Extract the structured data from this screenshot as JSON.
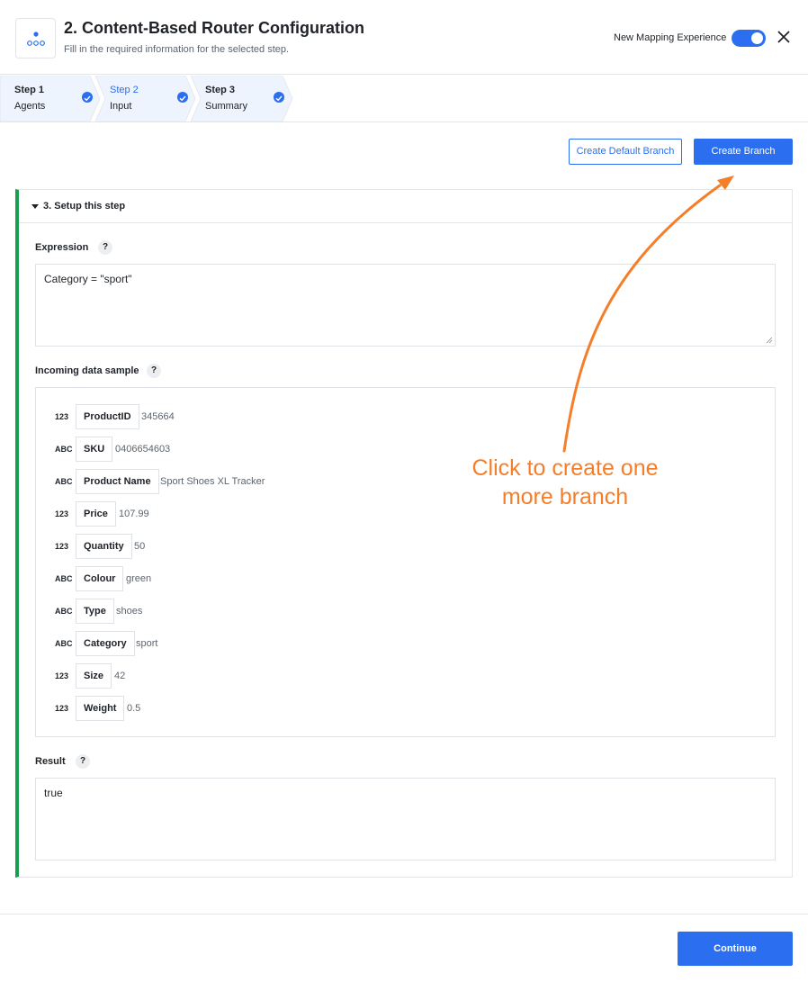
{
  "header": {
    "title": "2. Content-Based Router Configuration",
    "subtitle": "Fill in the required information for the selected step.",
    "toggle_label": "New Mapping Experience",
    "toggle_on": true,
    "app_icon": "router-icon",
    "close_icon": "close-icon"
  },
  "steps": [
    {
      "number": "Step 1",
      "name": "Agents",
      "completed": true
    },
    {
      "number": "Step 2",
      "name": "Input",
      "completed": true,
      "active": true
    },
    {
      "number": "Step 3",
      "name": "Summary",
      "completed": true
    }
  ],
  "actions": {
    "create_default_branch": "Create Default Branch",
    "create_branch": "Create Branch"
  },
  "section": {
    "title": "3. Setup this step",
    "expression_label": "Expression",
    "expression_value": "Category = \"sport\"",
    "sample_label": "Incoming data sample",
    "result_label": "Result",
    "result_value": "true",
    "help_glyph": "?"
  },
  "sample_fields": [
    {
      "type": "123",
      "key": "ProductID",
      "value": "345664"
    },
    {
      "type": "ABC",
      "key": "SKU",
      "value": "0406654603"
    },
    {
      "type": "ABC",
      "key": "Product Name",
      "value": "Sport Shoes XL Tracker"
    },
    {
      "type": "123",
      "key": "Price",
      "value": "107.99"
    },
    {
      "type": "123",
      "key": "Quantity",
      "value": "50"
    },
    {
      "type": "ABC",
      "key": "Colour",
      "value": "green"
    },
    {
      "type": "ABC",
      "key": "Type",
      "value": "shoes"
    },
    {
      "type": "ABC",
      "key": "Category",
      "value": "sport"
    },
    {
      "type": "123",
      "key": "Size",
      "value": "42"
    },
    {
      "type": "123",
      "key": "Weight",
      "value": "0.5"
    }
  ],
  "annotation": {
    "line1": "Click to create one",
    "line2": "more branch",
    "color": "#f47e2a"
  },
  "footer": {
    "continue_label": "Continue"
  },
  "colors": {
    "accent": "#2b6ff0",
    "section_bar": "#1a9e50"
  }
}
